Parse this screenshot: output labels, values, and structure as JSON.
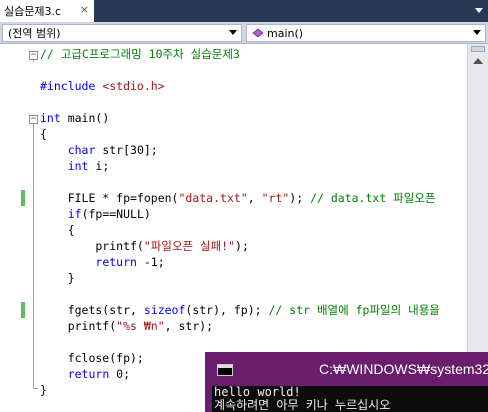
{
  "tab": {
    "label": "실습문제3.c",
    "close": "×"
  },
  "navbar": {
    "scope": "(전역 범위)",
    "member": "main()"
  },
  "code": [
    {
      "parts": [
        {
          "c": "cm",
          "t": "// 고급C프로그래밍 10주차 실습문제3"
        }
      ]
    },
    {
      "parts": []
    },
    {
      "parts": [
        {
          "c": "pp",
          "t": "#include "
        },
        {
          "c": "st",
          "t": "<stdio.h>"
        }
      ]
    },
    {
      "parts": []
    },
    {
      "parts": [
        {
          "c": "kw",
          "t": "int"
        },
        {
          "c": "",
          "t": " main()"
        }
      ]
    },
    {
      "parts": [
        {
          "c": "",
          "t": "{"
        }
      ]
    },
    {
      "parts": [
        {
          "c": "",
          "t": "    "
        },
        {
          "c": "kw",
          "t": "char"
        },
        {
          "c": "",
          "t": " str[30];"
        }
      ]
    },
    {
      "parts": [
        {
          "c": "",
          "t": "    "
        },
        {
          "c": "kw",
          "t": "int"
        },
        {
          "c": "",
          "t": " i;"
        }
      ]
    },
    {
      "parts": []
    },
    {
      "parts": [
        {
          "c": "",
          "t": "    FILE * fp=fopen("
        },
        {
          "c": "st",
          "t": "\"data.txt\""
        },
        {
          "c": "",
          "t": ", "
        },
        {
          "c": "st",
          "t": "\"rt\""
        },
        {
          "c": "",
          "t": "); "
        },
        {
          "c": "cm",
          "t": "// data.txt 파일오픈"
        }
      ]
    },
    {
      "parts": [
        {
          "c": "",
          "t": "    "
        },
        {
          "c": "kw",
          "t": "if"
        },
        {
          "c": "",
          "t": "(fp==NULL)"
        }
      ]
    },
    {
      "parts": [
        {
          "c": "",
          "t": "    {"
        }
      ]
    },
    {
      "parts": [
        {
          "c": "",
          "t": "        printf("
        },
        {
          "c": "st",
          "t": "\"파일오픈 실패!\""
        },
        {
          "c": "",
          "t": ");"
        }
      ]
    },
    {
      "parts": [
        {
          "c": "",
          "t": "        "
        },
        {
          "c": "kw",
          "t": "return"
        },
        {
          "c": "",
          "t": " -1;"
        }
      ]
    },
    {
      "parts": [
        {
          "c": "",
          "t": "    }"
        }
      ]
    },
    {
      "parts": []
    },
    {
      "parts": [
        {
          "c": "",
          "t": "    fgets(str, "
        },
        {
          "c": "kw",
          "t": "sizeof"
        },
        {
          "c": "",
          "t": "(str), fp); "
        },
        {
          "c": "cm",
          "t": "// str 배열에 fp파일의 내용을"
        }
      ]
    },
    {
      "parts": [
        {
          "c": "",
          "t": "    printf("
        },
        {
          "c": "st",
          "t": "\"%s ₩n\""
        },
        {
          "c": "",
          "t": ", str);"
        }
      ]
    },
    {
      "parts": []
    },
    {
      "parts": [
        {
          "c": "",
          "t": "    fclose(fp);"
        }
      ]
    },
    {
      "parts": [
        {
          "c": "",
          "t": "    "
        },
        {
          "c": "kw",
          "t": "return"
        },
        {
          "c": "",
          "t": " 0;"
        }
      ]
    },
    {
      "parts": [
        {
          "c": "",
          "t": "}"
        }
      ]
    }
  ],
  "console": {
    "title": "C:₩WINDOWS₩system32",
    "lines": [
      "hello world!",
      "계속하려면 아무 키나 누르십시오"
    ]
  },
  "colors": {
    "change_bar": "#57c057",
    "tab_strip": "#293955",
    "console_frame": "#6b1d6d",
    "keyword": "#0000ff",
    "comment": "#008000",
    "string": "#a31515"
  },
  "icons": [
    "close-icon",
    "chevron-down-icon",
    "method-icon",
    "split-handle-icon",
    "scroll-up-icon",
    "console-app-icon"
  ]
}
